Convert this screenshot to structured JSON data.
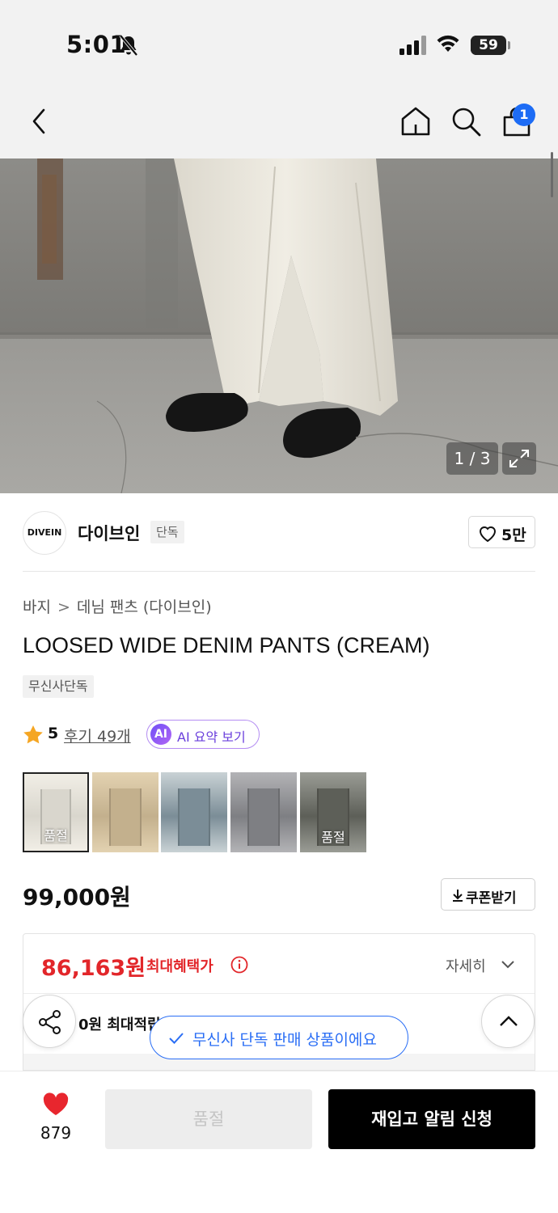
{
  "status_bar": {
    "time": "5:01",
    "battery": "59",
    "battery_level": 0.59
  },
  "nav": {
    "cart_count": "1"
  },
  "gallery": {
    "counter": "1 / 3"
  },
  "brand": {
    "logo_text": "DIVEIN",
    "name": "다이브인",
    "tag": "단독",
    "like_count": "5만"
  },
  "breadcrumb": [
    "바지",
    "데님 팬츠 (다이브인)"
  ],
  "product": {
    "title": "LOOSED WIDE DENIM PANTS (CREAM)",
    "exclusive_tag": "무신사단독",
    "rating": "5",
    "review_link": "후기 49개",
    "ai_badge": "AI",
    "ai_summary": "AI 요약 보기"
  },
  "thumbnails": [
    {
      "label": "품절",
      "colors": [
        "#d9d6cd",
        "#f1eee6"
      ]
    },
    {
      "label": "",
      "colors": [
        "#c3b08d",
        "#e3d2b1"
      ]
    },
    {
      "label": "",
      "colors": [
        "#7b8d97",
        "#c9d2d5"
      ]
    },
    {
      "label": "",
      "colors": [
        "#7e7f83",
        "#b3b3b6"
      ]
    },
    {
      "label": "품절",
      "colors": [
        "#5d5f58",
        "#9a9c95"
      ]
    }
  ],
  "pricing": {
    "price": "99,000원",
    "coupon": "쿠폰받기",
    "benefit_price": "86,163원",
    "benefit_label": "최대혜택가",
    "detail": "자세히",
    "point_text": "0원 최대적립"
  },
  "toast": {
    "text": "무신사 단독 판매 상품이에요"
  },
  "bottom_bar": {
    "wish_count": "879",
    "soldout": "품절",
    "restock": "재입고 알림 신청"
  },
  "colors": {
    "accent_red": "#e2262a",
    "accent_blue": "#2a6ef5",
    "badge_blue": "#1d6cf5",
    "heart_red": "#e8262e"
  }
}
